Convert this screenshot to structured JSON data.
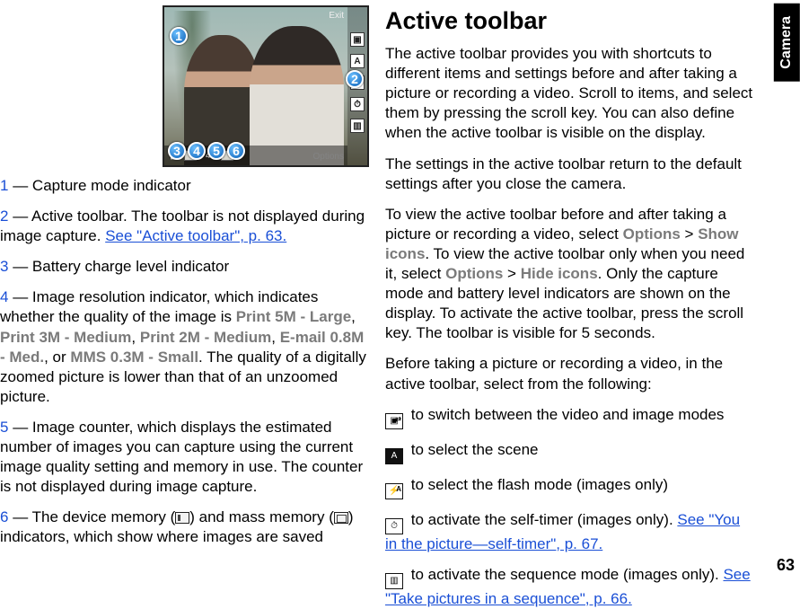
{
  "sidebar": {
    "section": "Camera",
    "page_number": "63"
  },
  "image": {
    "exit_label": "Exit",
    "options_label": "Options",
    "count_in_bar": "45",
    "toolbar_icons": {
      "scene": "A",
      "flash": "A",
      "mode": "▣"
    },
    "callouts": {
      "c1": "1",
      "c2": "2",
      "c3": "3",
      "c4": "4",
      "c5": "5",
      "c6": "6"
    }
  },
  "left": {
    "l1": {
      "num": "1",
      "text": " — Capture mode indicator"
    },
    "l2": {
      "num": "2",
      "text_a": " — Active toolbar. The toolbar is not displayed during image capture. ",
      "link": "See \"Active toolbar\", p. 63."
    },
    "l3": {
      "num": "3",
      "text": " — Battery charge level indicator"
    },
    "l4": {
      "num": "4",
      "a": " — Image resolution indicator, which indicates whether the quality of the image is ",
      "o1": "Print 5M - Large",
      "s1": ", ",
      "o2": "Print 3M - Medium",
      "s2": ", ",
      "o3": "Print 2M - Medium",
      "s3": ", ",
      "o4": "E-mail 0.8M - Med.",
      "s4": ", or ",
      "o5": "MMS 0.3M - Small",
      "b": ". The quality of a digitally zoomed picture is lower than that of an unzoomed picture."
    },
    "l5": {
      "num": "5",
      "text": " — Image counter, which displays the estimated number of images you can capture using the current image quality setting and memory in use. The counter is not displayed during image capture."
    },
    "l6": {
      "num": "6",
      "a": " — The device memory (",
      "b": ") and mass memory (",
      "c": ") indicators, which show where images are saved"
    }
  },
  "right": {
    "heading": "Active toolbar",
    "p1": "The active toolbar provides you with shortcuts to different items and settings before and after taking a picture or recording a video. Scroll to items, and select them by pressing the scroll key. You can also define when the active toolbar is visible on the display.",
    "p2": "The settings in the active toolbar return to the default settings after you close the camera.",
    "p3": {
      "a": "To view the active toolbar before and after taking a picture or recording a video, select ",
      "o1": "Options",
      "gt1": " > ",
      "o2": "Show icons",
      "b": ". To view the active toolbar only when you need it, select ",
      "o3": "Options",
      "gt2": " > ",
      "o4": "Hide icons",
      "c": ". Only the capture mode and battery level indicators are shown on the display. To activate the active toolbar, press the scroll key. The toolbar is visible for 5 seconds."
    },
    "p4": "Before taking a picture or recording a video, in the active toolbar, select from the following:",
    "b1": " to switch between the video and image modes",
    "b2": " to select the scene",
    "b3": " to select the flash mode (images only)",
    "b4": {
      "t": " to activate the self-timer (images only). ",
      "link": "See \"You in the picture—self-timer\", p. 67."
    },
    "b5": {
      "t": " to activate the sequence mode (images only). ",
      "link": "See \"Take pictures in a sequence\", p. 66."
    }
  }
}
